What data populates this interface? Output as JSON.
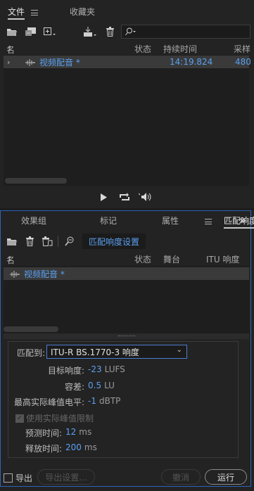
{
  "top": {
    "tabs": [
      {
        "label": "文件"
      },
      {
        "label": "收藏夹"
      }
    ],
    "columns": {
      "name": "名称",
      "status": "状态",
      "duration": "持续时间",
      "rate": "采样"
    },
    "row": {
      "name": "视频配音 *",
      "duration": "14:19.824",
      "rate": "480"
    }
  },
  "bottom": {
    "tabs": [
      {
        "label": "效果组"
      },
      {
        "label": "标记"
      },
      {
        "label": "属性"
      },
      {
        "label": "匹配响度"
      }
    ],
    "settings_tab": "匹配响度设置",
    "columns": {
      "name": "名称",
      "status": "状态",
      "stage": "舞台",
      "itu": "ITU 响度"
    },
    "row": {
      "name": "视频配音 *"
    },
    "match_to_label": "匹配到:",
    "match_to_value": "ITU-R BS.1770-3 响度",
    "target_loudness": {
      "label": "目标响度:",
      "value": "-23",
      "unit": "LUFS"
    },
    "tolerance": {
      "label": "容差:",
      "value": "0.5",
      "unit": "LU"
    },
    "max_true_peak": {
      "label": "最高实际峰值电平:",
      "value": "-1",
      "unit": "dBTP"
    },
    "use_limit": {
      "label": "使用实际峰值限制"
    },
    "lookahead": {
      "label": "预测时间:",
      "value": "12",
      "unit": "ms"
    },
    "release": {
      "label": "释放时间:",
      "value": "200",
      "unit": "ms"
    },
    "export_label": "导出",
    "export_settings": "导出设置...",
    "cancel": "撤消",
    "run": "运行"
  },
  "colors": {
    "accent": "#5aa0f0",
    "focus": "#2e62b8"
  }
}
